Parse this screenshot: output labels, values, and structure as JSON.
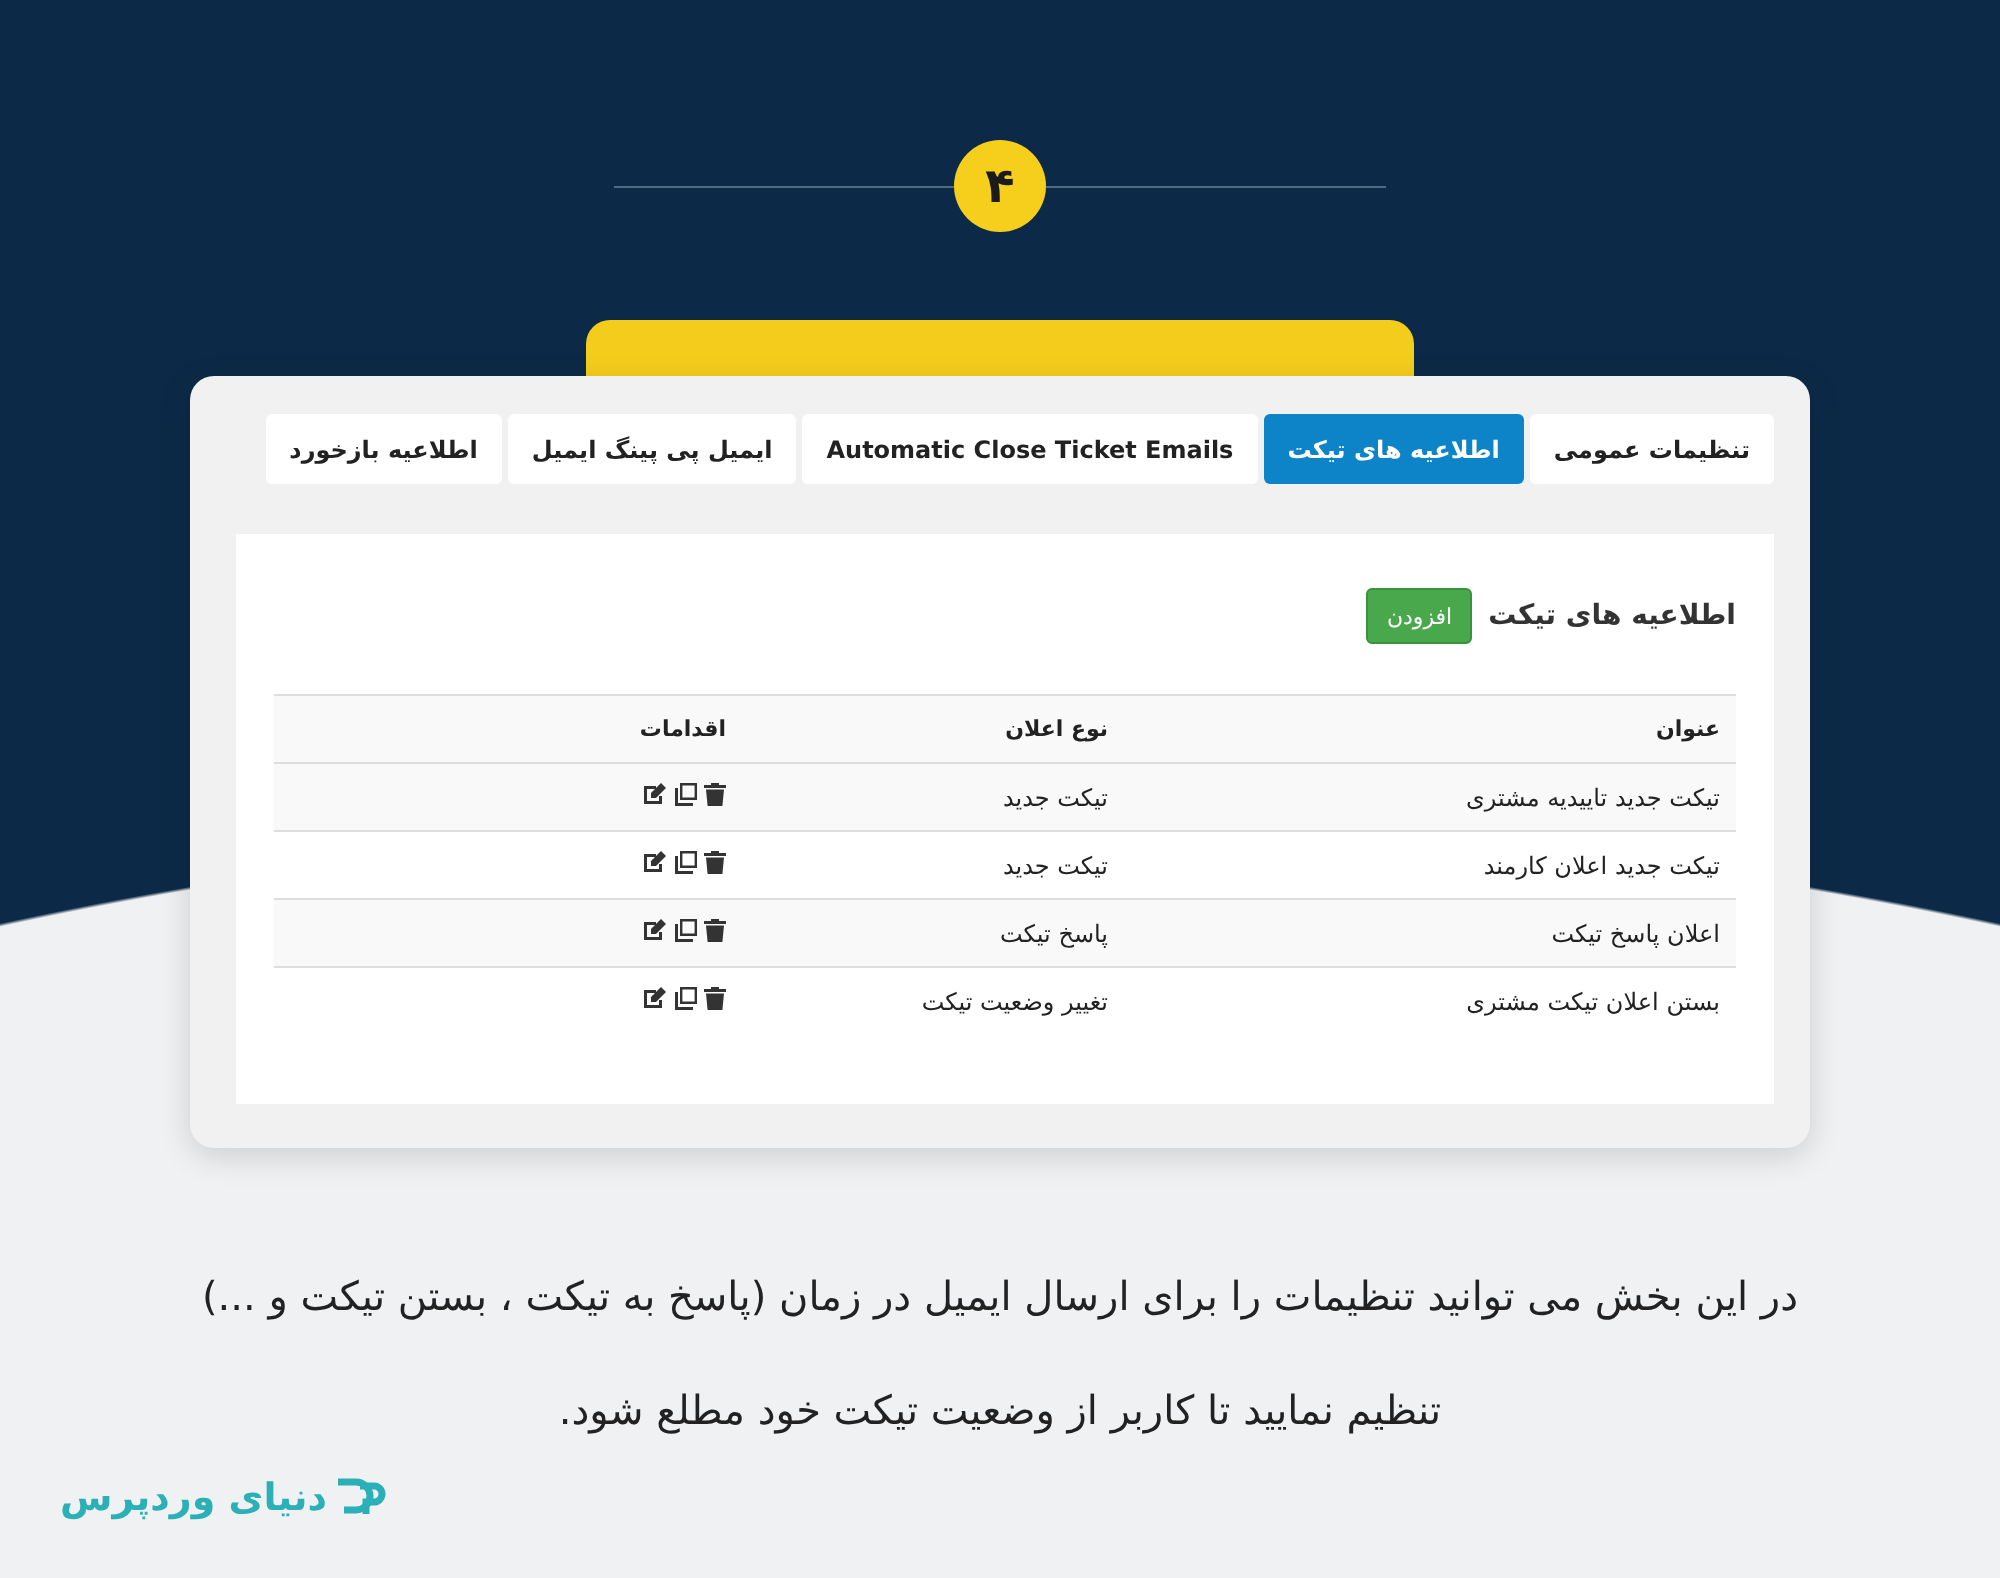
{
  "step_badge": "۴",
  "tabs": [
    {
      "label": "تنظیمات عمومی",
      "selected": false
    },
    {
      "label": "اطلاعیه های تیکت",
      "selected": true
    },
    {
      "label": "Automatic Close Ticket Emails",
      "selected": false
    },
    {
      "label": "ایمیل پی پینگ ایمیل",
      "selected": false
    },
    {
      "label": "اطلاعیه بازخورد",
      "selected": false
    }
  ],
  "section": {
    "title": "اطلاعیه های تیکت",
    "add_button": "افزودن"
  },
  "table": {
    "columns": [
      "عنوان",
      "نوع اعلان",
      "اقدامات"
    ],
    "rows": [
      {
        "title": "تیکت جدید تاییدیه مشتری",
        "type": "تیکت جدید"
      },
      {
        "title": "تیکت جدید اعلان کارمند",
        "type": "تیکت جدید"
      },
      {
        "title": "اعلان پاسخ تیکت",
        "type": "پاسخ تیکت"
      },
      {
        "title": "بستن اعلان تیکت مشتری",
        "type": "تغییر وضعیت تیکت"
      }
    ]
  },
  "caption": [
    "در این بخش می توانید تنظیمات را برای ارسال ایمیل در زمان (پاسخ به تیکت ، بستن تیکت و ...)",
    "تنظیم نمایید تا کاربر از وضعیت تیکت خود مطلع شود."
  ],
  "logo": "دنیای وردپرس"
}
